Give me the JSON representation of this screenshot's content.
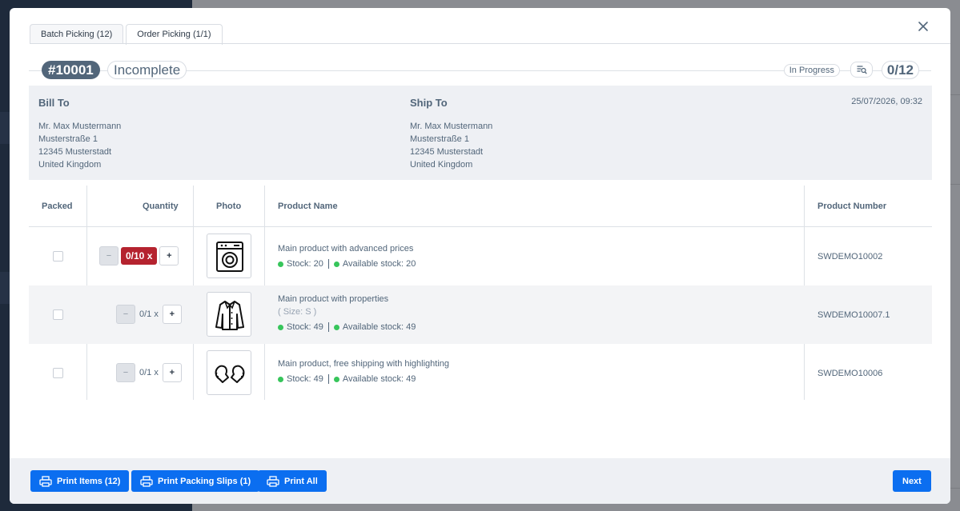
{
  "tabs": [
    {
      "label": "Batch Picking (12)",
      "active": false
    },
    {
      "label": "Order Picking (1/1)",
      "active": true
    }
  ],
  "order": {
    "id": "#10001",
    "status": "Incomplete",
    "progress_label": "In Progress",
    "picked_count": "0/12"
  },
  "bill_to": {
    "heading": "Bill To",
    "lines": [
      "Mr. Max Mustermann",
      "Musterstraße 1",
      "12345 Musterstadt",
      "United Kingdom"
    ]
  },
  "ship_to": {
    "heading": "Ship To",
    "lines": [
      "Mr. Max Mustermann",
      "Musterstraße 1",
      "12345 Musterstadt",
      "United Kingdom"
    ]
  },
  "order_date": "25/07/2026, 09:32",
  "table": {
    "headers": {
      "packed": "Packed",
      "quantity": "Quantity",
      "photo": "Photo",
      "product_name": "Product Name",
      "product_number": "Product Number"
    },
    "rows": [
      {
        "packed": false,
        "quantity": "0/10 x",
        "quantity_alert": true,
        "photo_icon": "washing-machine-icon",
        "name": "Main product with advanced prices",
        "variant": "",
        "stock": "Stock: 20",
        "available_stock": "Available stock: 20",
        "number": "SWDEMO10002"
      },
      {
        "packed": false,
        "quantity": "0/1 x",
        "quantity_alert": false,
        "photo_icon": "jacket-icon",
        "name": "Main product with properties",
        "variant": "( Size: S )",
        "stock": "Stock: 49",
        "available_stock": "Available stock: 49",
        "number": "SWDEMO10007.1"
      },
      {
        "packed": false,
        "quantity": "0/1 x",
        "quantity_alert": false,
        "photo_icon": "mittens-icon",
        "name": "Main product, free shipping with highlighting",
        "variant": "",
        "stock": "Stock: 49",
        "available_stock": "Available stock: 49",
        "number": "SWDEMO10006"
      }
    ],
    "minus_label": "−",
    "plus_label": "+"
  },
  "footer": {
    "print_items": "Print Items (12)",
    "print_slips": "Print Packing Slips (1)",
    "print_all": "Print All",
    "next": "Next"
  },
  "colors": {
    "primary": "#0b6ef0",
    "danger": "#b5232f",
    "stock_ok": "#37c55b",
    "badge_dark": "#52667a"
  }
}
